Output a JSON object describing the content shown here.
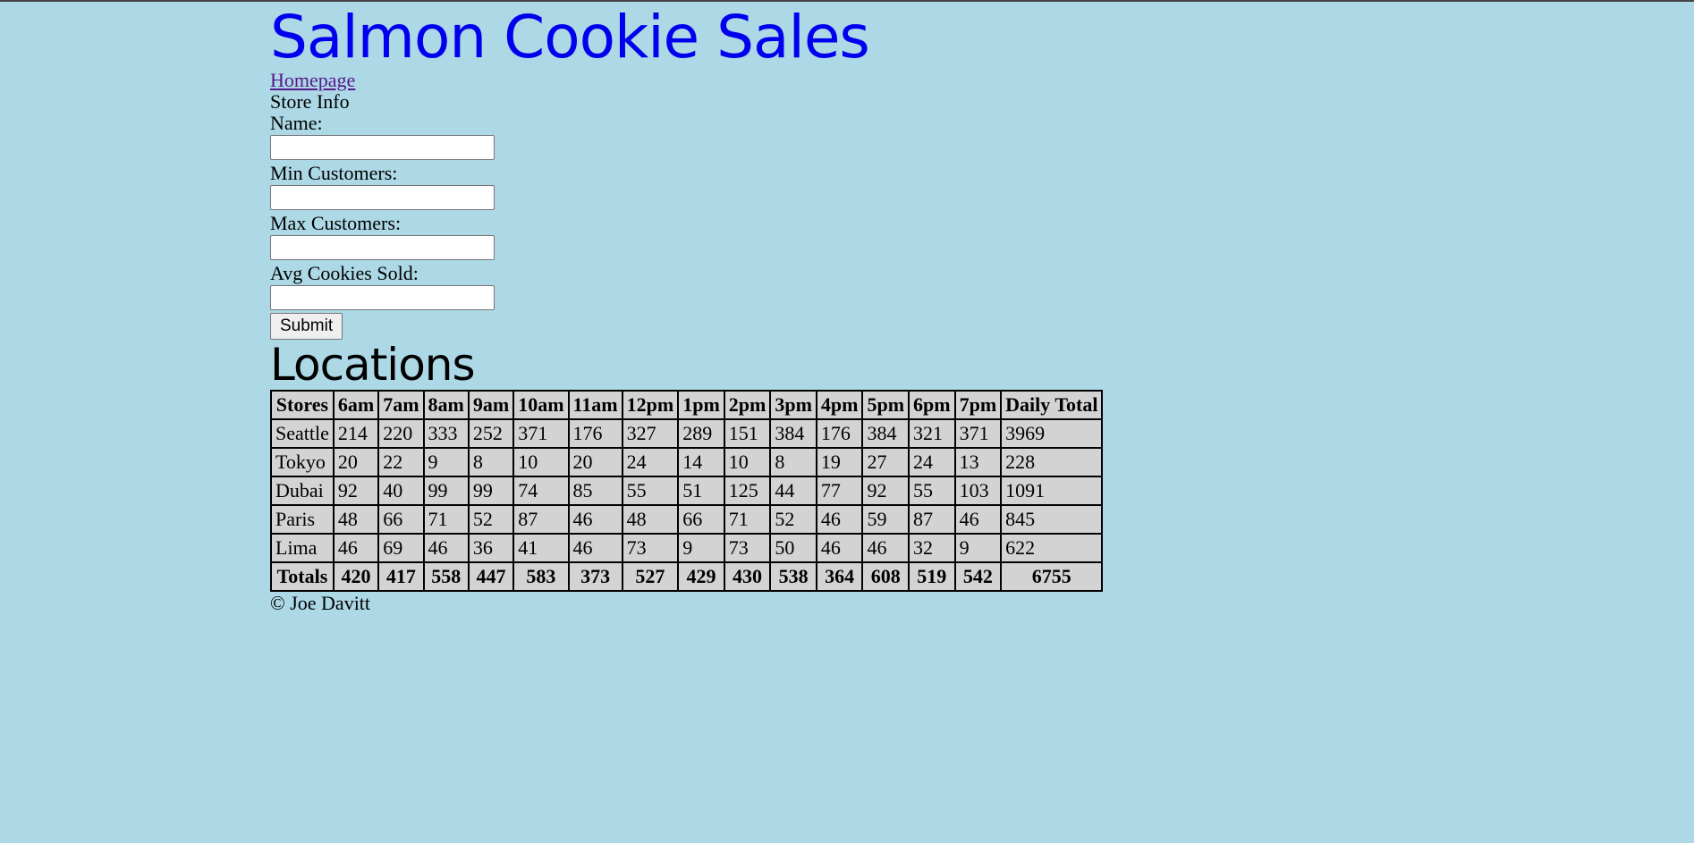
{
  "header": {
    "title": "Salmon Cookie Sales"
  },
  "nav": {
    "home_link": "Homepage"
  },
  "form": {
    "legend": "Store Info",
    "fields": [
      {
        "label": "Name:",
        "value": ""
      },
      {
        "label": "Min Customers:",
        "value": ""
      },
      {
        "label": "Max Customers:",
        "value": ""
      },
      {
        "label": "Avg Cookies Sold:",
        "value": ""
      }
    ],
    "submit_label": "Submit"
  },
  "locations": {
    "heading": "Locations",
    "columns": [
      "Stores",
      "6am",
      "7am",
      "8am",
      "9am",
      "10am",
      "11am",
      "12pm",
      "1pm",
      "2pm",
      "3pm",
      "4pm",
      "5pm",
      "6pm",
      "7pm",
      "Daily Total"
    ],
    "rows": [
      [
        "Seattle",
        "214",
        "220",
        "333",
        "252",
        "371",
        "176",
        "327",
        "289",
        "151",
        "384",
        "176",
        "384",
        "321",
        "371",
        "3969"
      ],
      [
        "Tokyo",
        "20",
        "22",
        "9",
        "8",
        "10",
        "20",
        "24",
        "14",
        "10",
        "8",
        "19",
        "27",
        "24",
        "13",
        "228"
      ],
      [
        "Dubai",
        "92",
        "40",
        "99",
        "99",
        "74",
        "85",
        "55",
        "51",
        "125",
        "44",
        "77",
        "92",
        "55",
        "103",
        "1091"
      ],
      [
        "Paris",
        "48",
        "66",
        "71",
        "52",
        "87",
        "46",
        "48",
        "66",
        "71",
        "52",
        "46",
        "59",
        "87",
        "46",
        "845"
      ],
      [
        "Lima",
        "46",
        "69",
        "46",
        "36",
        "41",
        "46",
        "73",
        "9",
        "73",
        "50",
        "46",
        "46",
        "32",
        "9",
        "622"
      ]
    ],
    "totals": [
      "Totals",
      "420",
      "417",
      "558",
      "447",
      "583",
      "373",
      "527",
      "429",
      "430",
      "538",
      "364",
      "608",
      "519",
      "542",
      "6755"
    ]
  },
  "footer": {
    "copyright": "© Joe Davitt"
  }
}
